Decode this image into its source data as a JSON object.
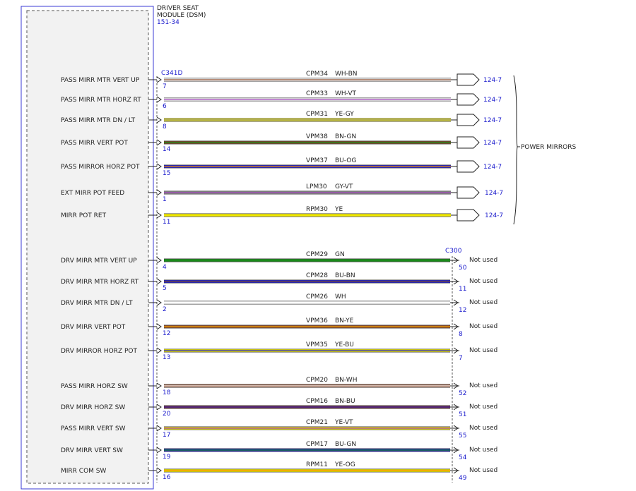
{
  "module": {
    "title_line1": "DRIVER SEAT",
    "title_line2": "MODULE (DSM)",
    "ref": "151-34"
  },
  "connectors": {
    "left": "C341D",
    "right": "C300"
  },
  "group_label": "POWER MIRRORS",
  "not_used_label": "Not used",
  "circuits": [
    {
      "label": "PASS MIRR MTR VERT UP",
      "pin": "7",
      "circuit": "CPM34",
      "color_code": "WH-BN",
      "colors": [
        "#ffffff",
        "#8b4a2b"
      ],
      "end": "arrow",
      "dest": "124-7"
    },
    {
      "label": "PASS MIRR MTR HORZ RT",
      "pin": "6",
      "circuit": "CPM33",
      "color_code": "WH-VT",
      "colors": [
        "#ffffff",
        "#9b3fb5"
      ],
      "end": "arrow",
      "dest": "124-7"
    },
    {
      "label": "PASS MIRR MTR DN / LT",
      "pin": "8",
      "circuit": "CPM31",
      "color_code": "YE-GY",
      "colors": [
        "#f0e800",
        "#8a8a8a"
      ],
      "end": "arrow",
      "dest": "124-7"
    },
    {
      "label": "PASS MIRR VERT POT",
      "pin": "14",
      "circuit": "VPM38",
      "color_code": "BN-GN",
      "colors": [
        "#7a4a2a",
        "#1a8a1a"
      ],
      "end": "arrow",
      "dest": "124-7"
    },
    {
      "label": "PASS MIRROR HORZ POT",
      "pin": "15",
      "circuit": "VPM37",
      "color_code": "BU-OG",
      "colors": [
        "#1f1fd0",
        "#f08a00"
      ],
      "end": "arrow",
      "dest": "124-7"
    },
    {
      "label": "EXT MIRR POT FEED",
      "pin": "1",
      "circuit": "LPM30",
      "color_code": "GY-VT",
      "colors": [
        "#8e8e8e",
        "#9b3fb5"
      ],
      "end": "arrow",
      "dest": "124-7"
    },
    {
      "label": "MIRR POT RET",
      "pin": "11",
      "circuit": "RPM30",
      "color_code": "YE",
      "colors": [
        "#f0e800",
        "#f0e800"
      ],
      "end": "arrow",
      "dest": "124-7"
    },
    {
      "label": "DRV MIRR MTR VERT UP",
      "pin": "4",
      "circuit": "CPM29",
      "color_code": "GN",
      "colors": [
        "#1a8a1a",
        "#1a8a1a"
      ],
      "end": "notused",
      "rpin": "50"
    },
    {
      "label": "DRV MIRR MTR HORZ RT",
      "pin": "5",
      "circuit": "CPM28",
      "color_code": "BU-BN",
      "colors": [
        "#1f1fd0",
        "#7a4a2a"
      ],
      "end": "notused",
      "rpin": "11"
    },
    {
      "label": "DRV MIRR MTR DN / LT",
      "pin": "2",
      "circuit": "CPM26",
      "color_code": "WH",
      "colors": [
        "#ffffff",
        "#ffffff"
      ],
      "end": "notused",
      "rpin": "12"
    },
    {
      "label": "DRV MIRR VERT POT",
      "pin": "12",
      "circuit": "VPM36",
      "color_code": "BN-YE",
      "colors": [
        "#8b4a2b",
        "#f0a000"
      ],
      "end": "notused",
      "rpin": "8"
    },
    {
      "label": "DRV MIRROR HORZ POT",
      "pin": "13",
      "circuit": "VPM35",
      "color_code": "YE-BU",
      "colors": [
        "#f0e800",
        "#1f1fd0"
      ],
      "end": "notused",
      "rpin": "7"
    },
    {
      "label": "PASS MIRR HORZ SW",
      "pin": "18",
      "circuit": "CPM20",
      "color_code": "BN-WH",
      "colors": [
        "#8b4a2b",
        "#ffffff"
      ],
      "end": "notused",
      "rpin": "52"
    },
    {
      "label": "DRV MIRR HORZ SW",
      "pin": "20",
      "circuit": "CPM16",
      "color_code": "BN-BU",
      "colors": [
        "#7a3a3a",
        "#3a1aa0"
      ],
      "end": "notused",
      "rpin": "51"
    },
    {
      "label": "PASS MIRR VERT SW",
      "pin": "17",
      "circuit": "CPM21",
      "color_code": "YE-VT",
      "colors": [
        "#f0e800",
        "#9b3fb5"
      ],
      "end": "notused",
      "rpin": "55"
    },
    {
      "label": "DRV MIRR VERT SW",
      "pin": "19",
      "circuit": "CPM17",
      "color_code": "BU-GN",
      "colors": [
        "#1f1fd0",
        "#1a8a1a"
      ],
      "end": "notused",
      "rpin": "54"
    },
    {
      "label": "MIRR COM SW",
      "pin": "16",
      "circuit": "RPM11",
      "color_code": "YE-OG",
      "colors": [
        "#f0e800",
        "#f08a00"
      ],
      "end": "notused",
      "rpin": "49"
    }
  ]
}
